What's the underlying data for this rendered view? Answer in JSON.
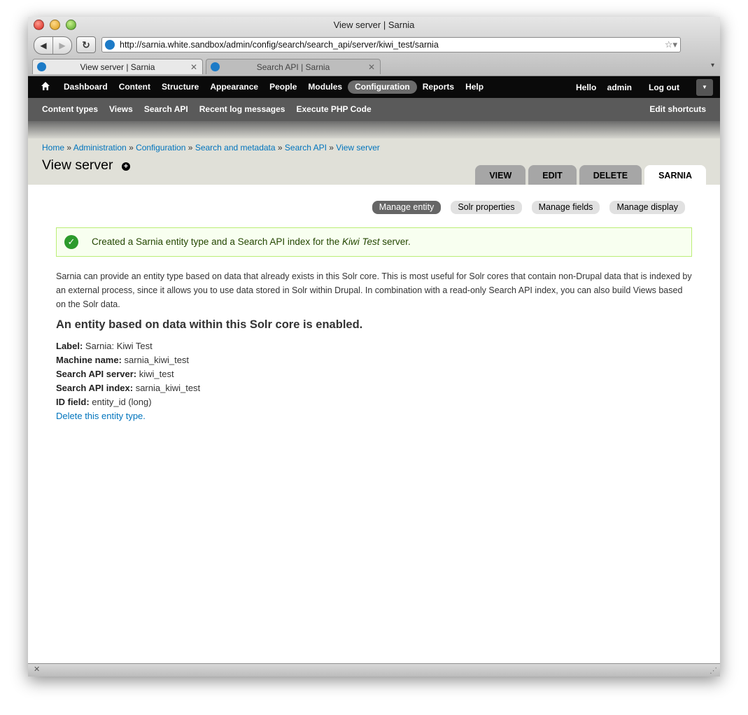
{
  "browser": {
    "window_title": "View server | Sarnia",
    "url": "http://sarnia.white.sandbox/admin/config/search/search_api/server/kiwi_test/sarnia",
    "tabs": [
      {
        "title": "View server | Sarnia"
      },
      {
        "title": "Search API | Sarnia"
      }
    ]
  },
  "toolbar": {
    "menu": [
      "Dashboard",
      "Content",
      "Structure",
      "Appearance",
      "People",
      "Modules",
      "Configuration",
      "Reports",
      "Help"
    ],
    "active": "Configuration",
    "hello": "Hello",
    "username": "admin",
    "logout": "Log out"
  },
  "shortcuts": {
    "items": [
      "Content types",
      "Views",
      "Search API",
      "Recent log messages",
      "Execute PHP Code"
    ],
    "edit": "Edit shortcuts"
  },
  "breadcrumb": [
    "Home",
    "Administration",
    "Configuration",
    "Search and metadata",
    "Search API",
    "View server"
  ],
  "page": {
    "title": "View server",
    "tabs": [
      "View",
      "Edit",
      "Delete",
      "Sarnia"
    ],
    "active_tab": "Sarnia"
  },
  "subtabs": {
    "items": [
      "Manage entity",
      "Solr properties",
      "Manage fields",
      "Manage display"
    ],
    "active": "Manage entity"
  },
  "message": {
    "before": "Created a Sarnia entity type and a Search API index for the ",
    "emphasis": "Kiwi Test",
    "after": " server."
  },
  "intro": "Sarnia can provide an entity type based on data that already exists in this Solr core. This is most useful for Solr cores that contain non-Drupal data that is indexed by an external process, since it allows you to use data stored in Solr within Drupal. In combination with a read-only Search API index, you can also build Views based on the Solr data.",
  "heading": "An entity based on data within this Solr core is enabled.",
  "details": [
    {
      "label": "Label:",
      "value": "Sarnia: Kiwi Test"
    },
    {
      "label": "Machine name:",
      "value": "sarnia_kiwi_test"
    },
    {
      "label": "Search API server:",
      "value": "kiwi_test"
    },
    {
      "label": "Search API index:",
      "value": "sarnia_kiwi_test"
    },
    {
      "label": "ID field:",
      "value": "entity_id (long)"
    }
  ],
  "delete_link": "Delete this entity type."
}
